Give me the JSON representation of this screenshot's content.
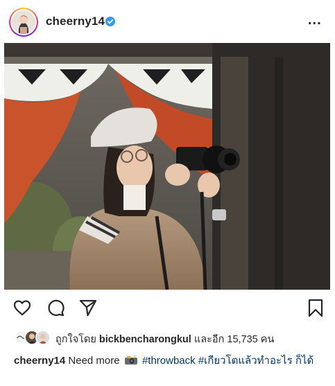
{
  "post": {
    "username": "cheerny14",
    "more_label": "...",
    "likes": {
      "prefix": "ถูกใจโดย",
      "liker": "bickbencharongkul",
      "suffix": "และอีก 15,735 คน"
    },
    "caption": {
      "username": "cheerny14",
      "text": "Need more",
      "emoji": "camera-flash-icon",
      "tag1": "#throwback",
      "tag2": "#เกียวโตแล้วทำอะไร",
      "tail": "ก็ได้"
    }
  },
  "colors": {
    "link": "#00376b",
    "verified": "#3897f0",
    "text": "#262626"
  },
  "icons": [
    "heart-icon",
    "comment-icon",
    "share-icon",
    "bookmark-icon",
    "verified-badge-icon",
    "more-icon"
  ]
}
